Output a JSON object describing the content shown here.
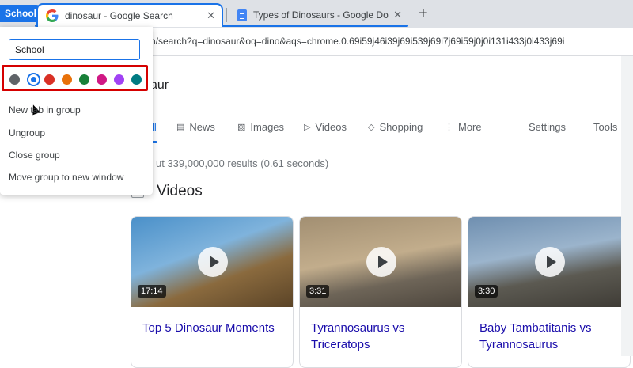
{
  "tabstrip": {
    "group_label": "School",
    "group_color": "#1a73e8",
    "tabs": [
      {
        "title": "dinosaur - Google Search",
        "icon": "google-icon",
        "active": true
      },
      {
        "title": "Types of Dinosaurs - Google Doc",
        "icon": "docs-icon",
        "active": false
      }
    ],
    "new_tab_label": "+"
  },
  "toolbar": {
    "url": "n/search?q=dinosaur&oq=dino&aqs=chrome.0.69i59j46i39j69i539j69i7j69i59j0j0i131i433j0i433j69i"
  },
  "search": {
    "query_text": "saur",
    "nav": [
      {
        "label": "ll",
        "icon": ""
      },
      {
        "label": "News",
        "icon": "news-icon"
      },
      {
        "label": "Images",
        "icon": "image-icon"
      },
      {
        "label": "Videos",
        "icon": "video-icon"
      },
      {
        "label": "Shopping",
        "icon": "tag-icon"
      },
      {
        "label": "More",
        "icon": "more-vert-icon"
      },
      {
        "label": "Settings",
        "icon": ""
      },
      {
        "label": "Tools",
        "icon": ""
      }
    ],
    "result_stats": "ut 339,000,000 results (0.61 seconds)",
    "videos_heading": "Videos",
    "videos": [
      {
        "title": "Top 5 Dinosaur Moments",
        "duration": "17:14"
      },
      {
        "title": "Tyrannosaurus vs Triceratops",
        "duration": "3:31"
      },
      {
        "title": "Baby Tambatitanis vs Tyrannosaurus",
        "duration": "3:30"
      }
    ]
  },
  "group_popup": {
    "name_value": "School",
    "colors": [
      "#5f6368",
      "#1a73e8",
      "#d93025",
      "#e8710a",
      "#188038",
      "#d01884",
      "#a142f4",
      "#007b83"
    ],
    "selected_color_index": 1,
    "menu_items": [
      "New tab in group",
      "Ungroup",
      "Close group",
      "Move group to new window"
    ]
  }
}
